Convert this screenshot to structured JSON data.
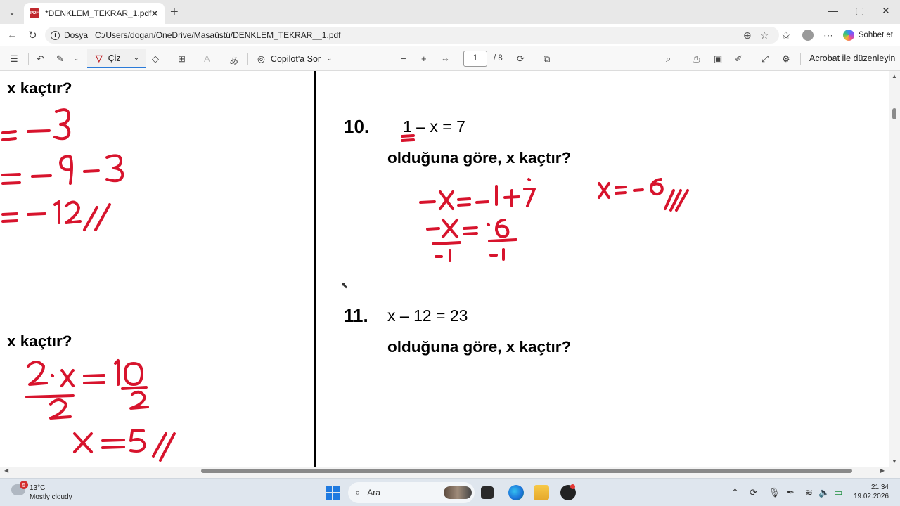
{
  "browser": {
    "tab_title": "*DENKLEM_TEKRAR_1.pdf",
    "tab_close": "✕",
    "new_tab": "+",
    "window_controls": [
      "—",
      "▢",
      "✕"
    ],
    "address_label": "Dosya",
    "url": "C:/Users/dogan/OneDrive/Masaüstü/DENKLEM_TEKRAR__1.pdf",
    "copilot_label": "Sohbet et"
  },
  "pdf_toolbar": {
    "draw_label": "Çiz",
    "copilot_label": "Copilot'a Sor",
    "page_current": "1",
    "page_total": "/ 8",
    "acrobat_label": "Acrobat ile düzenleyin"
  },
  "document": {
    "left_q_top": "x kaçtır?",
    "left_q_bottom": "x kaçtır?",
    "problem10": {
      "number": "10.",
      "equation": "1 – x = 7",
      "question": "olduğuna göre, x kaçtır?"
    },
    "problem11": {
      "number": "11.",
      "equation": "x – 12 = 23",
      "question": "olduğuna göre, x kaçtır?"
    },
    "ink_color": "#d7142d"
  },
  "taskbar": {
    "weather_temp": "13°C",
    "weather_desc": "Mostly cloudy",
    "weather_badge": "5",
    "search_label": "Ara",
    "time": "21:34",
    "date": "19.02.2026"
  }
}
